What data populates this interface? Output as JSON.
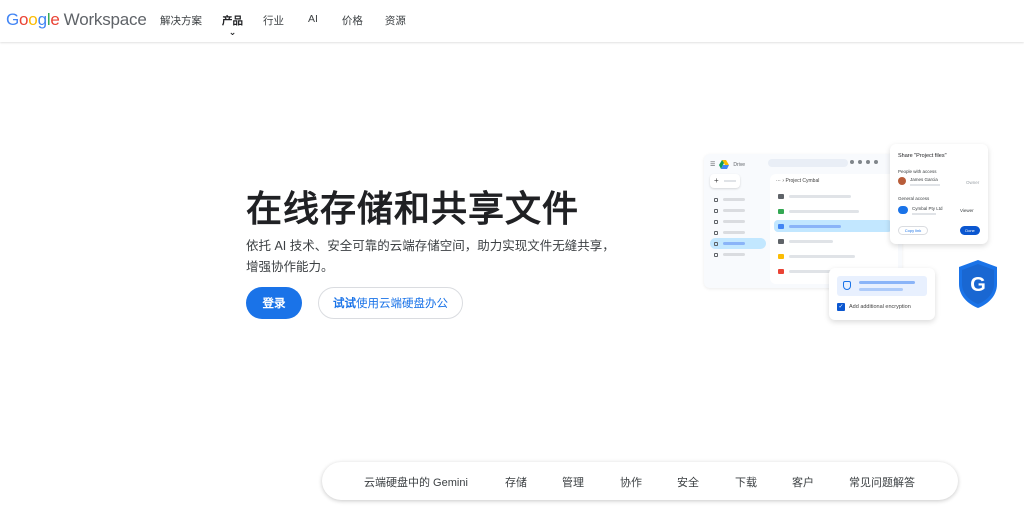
{
  "header": {
    "logo": {
      "google_letters": [
        {
          "ch": "G",
          "color": "#4285f4"
        },
        {
          "ch": "o",
          "color": "#ea4335"
        },
        {
          "ch": "o",
          "color": "#fbbc04"
        },
        {
          "ch": "g",
          "color": "#4285f4"
        },
        {
          "ch": "l",
          "color": "#34a853"
        },
        {
          "ch": "e",
          "color": "#ea4335"
        }
      ],
      "product": "Workspace"
    },
    "nav": [
      {
        "label": "解决方案",
        "active": false
      },
      {
        "label": "产品",
        "active": true
      },
      {
        "label": "行业",
        "active": false
      },
      {
        "label": "AI",
        "active": false
      },
      {
        "label": "价格",
        "active": false
      },
      {
        "label": "资源",
        "active": false
      }
    ],
    "chevron": "⌄"
  },
  "hero": {
    "title": "在线存储和共享文件",
    "description": "依托 AI 技术、安全可靠的云端存储空间，助力实现文件无缝共享，增强协作能力。",
    "primary_button": "登录",
    "secondary_button_bold": "试试",
    "secondary_button_rest": "使用云端硬盘办公"
  },
  "illustration": {
    "drive_label": "Drive",
    "breadcrumb": "Project Cymbal",
    "share_title": "Share \"Project files\"",
    "people_label": "People with access",
    "person_name": "James Garcia",
    "owner_label": "Owner",
    "general_label": "General access",
    "org_name": "Cymbal Pty Ltd",
    "viewer_label": "Viewer",
    "copy_link": "Copy link",
    "done": "Done",
    "encryption_label": "Add additional encryption"
  },
  "subnav": {
    "items": [
      "云端硬盘中的 Gemini",
      "存储",
      "管理",
      "协作",
      "安全",
      "下载",
      "客户",
      "常见问题解答"
    ]
  },
  "colors": {
    "accent": "#1a73e8",
    "shield": "#1a73e8"
  }
}
